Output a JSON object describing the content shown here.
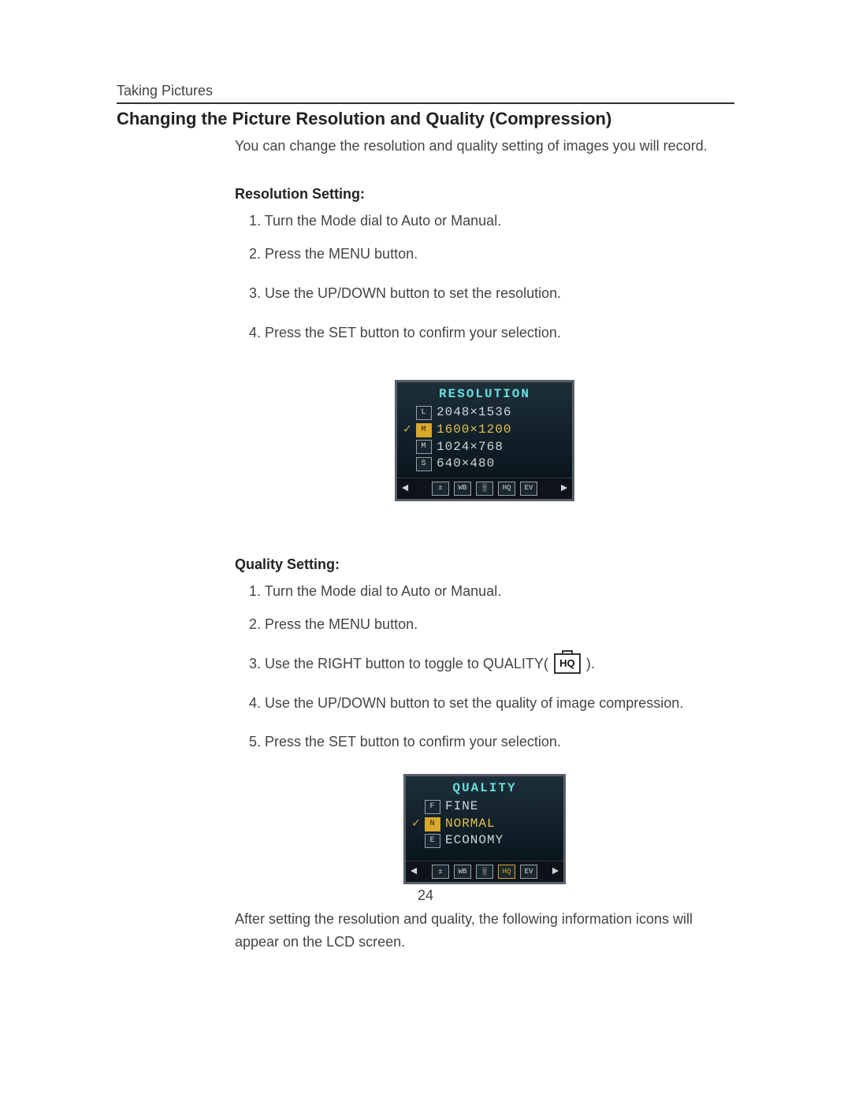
{
  "breadcrumb": "Taking Pictures",
  "title": "Changing the Picture Resolution and Quality (Compression)",
  "intro": "You can change the resolution and quality setting of images you will record.",
  "resolution": {
    "heading": "Resolution Setting:",
    "steps": [
      "1. Turn the Mode dial to Auto or Manual.",
      "2.  Press the MENU button.",
      "3. Use the UP/DOWN button to set the resolution.",
      "4. Press the SET button to confirm your selection."
    ],
    "menu_title": "RESOLUTION",
    "options": [
      {
        "badge": "L",
        "value": "2048×1536",
        "selected": false
      },
      {
        "badge": "M",
        "value": "1600×1200",
        "selected": true
      },
      {
        "badge": "M",
        "value": "1024×768",
        "selected": false
      },
      {
        "badge": "S",
        "value": "640×480",
        "selected": false
      }
    ]
  },
  "quality": {
    "heading": "Quality Setting:",
    "steps": [
      "1.   Turn the Mode dial to Auto or Manual.",
      "2.   Press the MENU button.",
      "3.   Use the RIGHT button to toggle to QUALITY(",
      "4.   Use the UP/DOWN button to set the quality of image compression.",
      "5.   Press the SET button to confirm your selection."
    ],
    "step3_suffix": " ).",
    "hq_icon_label": "HQ",
    "menu_title": "QUALITY",
    "options": [
      {
        "badge": "F",
        "value": "FINE",
        "selected": false
      },
      {
        "badge": "N",
        "value": "NORMAL",
        "selected": true
      },
      {
        "badge": "E",
        "value": "ECONOMY",
        "selected": false
      }
    ]
  },
  "bar_icons": [
    "±",
    "WB",
    "▒",
    "HQ",
    "EV"
  ],
  "after_text": "After setting the resolution and quality, the following information icons will appear on the LCD screen.",
  "page_number": "24"
}
